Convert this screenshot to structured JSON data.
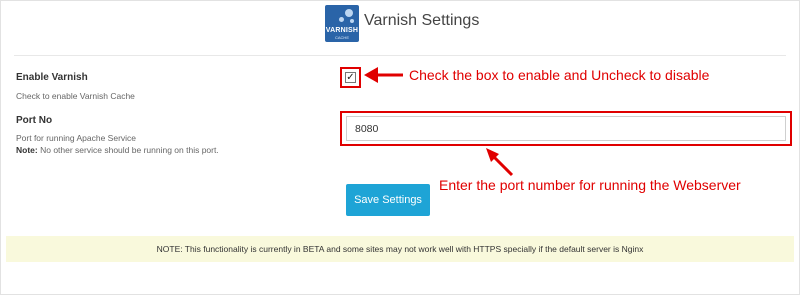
{
  "header": {
    "title": "Varnish Settings",
    "logo": {
      "word": "VARNISH",
      "sub": "CACHE"
    }
  },
  "enable_varnish": {
    "label": "Enable Varnish",
    "help": "Check to enable Varnish Cache",
    "checked": true
  },
  "port": {
    "label": "Port No",
    "help": "Port for running Apache Service",
    "note_label": "Note:",
    "note_text": " No other service should be running on this port.",
    "value": "8080"
  },
  "save_button": {
    "label": "Save Settings"
  },
  "notice": "NOTE: This functionality is currently in BETA and some sites may not work well with HTTPS specially if the default server is Nginx",
  "annotations": {
    "checkbox": "Check the box to enable and Uncheck to disable",
    "port": "Enter the port number for running the Webserver"
  },
  "colors": {
    "highlight": "#e00000",
    "button": "#1ea4d6",
    "notice_bg": "#f9f9dc"
  },
  "icons": {
    "checkbox": "check-icon"
  }
}
